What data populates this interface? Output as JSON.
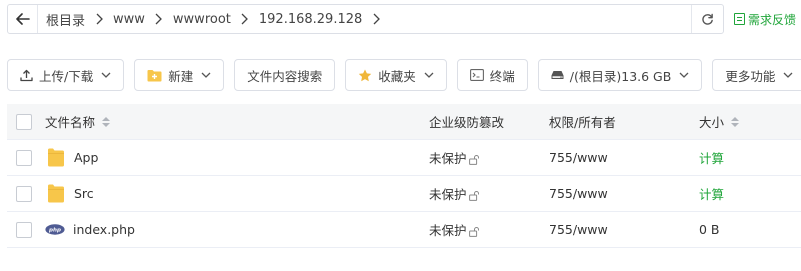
{
  "path": {
    "crumbs": [
      "根目录",
      "www",
      "wwwroot",
      "192.168.29.128"
    ]
  },
  "feedback_label": "需求反馈",
  "toolbar": {
    "upload_label": "上传/下载",
    "new_label": "新建",
    "search_content_label": "文件内容搜索",
    "favorites_label": "收藏夹",
    "terminal_label": "终端",
    "disk_label": "/(根目录)13.6 GB",
    "more_label": "更多功能"
  },
  "table": {
    "headers": {
      "name": "文件名称",
      "protect": "企业级防篡改",
      "permission": "权限/所有者",
      "size": "大小"
    },
    "rows": [
      {
        "name": "App",
        "type": "folder",
        "protect": "未保护",
        "permission": "755/www",
        "size": "计算"
      },
      {
        "name": "Src",
        "type": "folder",
        "protect": "未保护",
        "permission": "755/www",
        "size": "计算"
      },
      {
        "name": "index.php",
        "type": "php",
        "protect": "未保护",
        "permission": "755/www",
        "size": "0 B"
      }
    ]
  },
  "colors": {
    "accent_green": "#20a53a",
    "folder_yellow": "#f7c64a",
    "php_blue": "#4f5b93"
  }
}
